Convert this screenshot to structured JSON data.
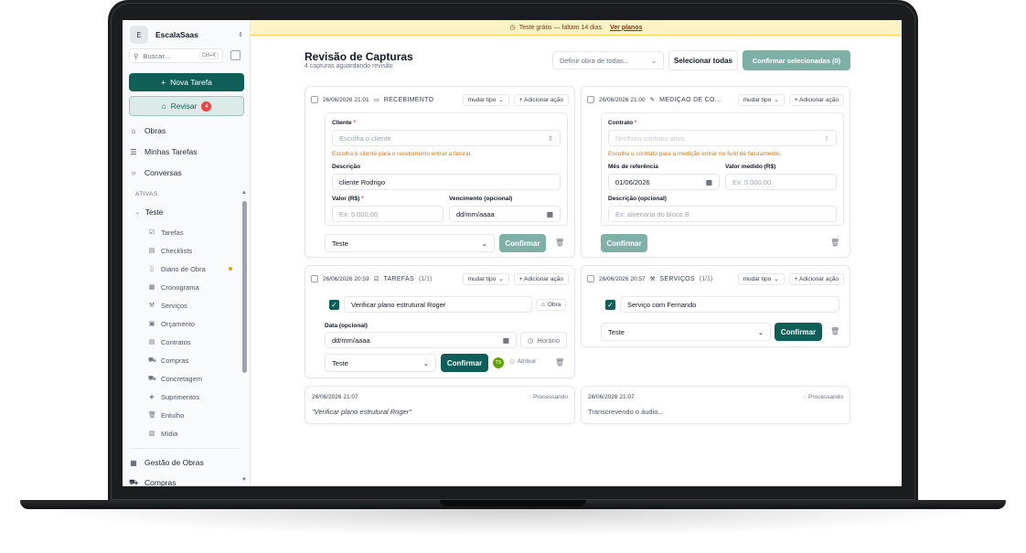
{
  "colors": {
    "brand": "#0f5e57",
    "brand_light": "#dcebe8",
    "warning_text": "#d97706",
    "banner_bg": "#fef3c7",
    "danger": "#ef4444"
  },
  "sidebar": {
    "workspace_initial": "E",
    "workspace_name": "EscalaSaas",
    "search_placeholder": "Buscar...",
    "search_shortcut": "Ctrl+K",
    "new_task_label": "Nova Tarefa",
    "review_label": "Revisar",
    "review_count": "4",
    "nav": [
      {
        "label": "Obras",
        "icon": "home-icon"
      },
      {
        "label": "Minhas Tarefas",
        "icon": "list-icon"
      },
      {
        "label": "Conversas",
        "icon": "chat-icon"
      }
    ],
    "section_label": "ATIVAS",
    "project_name": "Teste",
    "sub_items": [
      "Tarefas",
      "Checklists",
      "Diário de Obra",
      "Cronograma",
      "Serviços",
      "Orçamento",
      "Contratos",
      "Compras",
      "Concretagem",
      "Suprimentos",
      "Entulho",
      "Mídia"
    ],
    "bottom_nav": [
      "Gestão de Obras",
      "Compras"
    ]
  },
  "banner": {
    "text": "Teste grátis — faltam 14 dias.",
    "link": "Ver planos"
  },
  "header": {
    "title": "Revisão de Capturas",
    "subtitle": "4 capturas aguardando revisão",
    "obra_select_placeholder": "Definir obra de todas...",
    "select_all": "Selecionar todas",
    "confirm_selected": "Confirmar selecionadas (0)"
  },
  "common": {
    "change_type": "mudar tipo",
    "add_action": "+ Adicionar ação",
    "confirm": "Confirmar",
    "obra_value": "Teste"
  },
  "cards": {
    "recebimento": {
      "timestamp": "26/06/2026 21:01",
      "type": "RECEBIMENTO",
      "cliente_label": "Cliente",
      "cliente_placeholder": "Escolha o cliente",
      "cliente_warning": "Escolha o cliente para o recebimento entrar a faturar.",
      "descricao_label": "Descrição",
      "descricao_value": "cliente Rodrigo",
      "valor_label": "Valor (R$)",
      "valor_placeholder": "Ex: 5.000,00",
      "vencimento_label": "Vencimento (opcional)",
      "vencimento_placeholder": "dd/mm/aaaa"
    },
    "medicao": {
      "timestamp": "26/06/2026 21:00",
      "type": "MEDIÇÃO DE CO...",
      "contrato_label": "Contrato",
      "contrato_placeholder": "Nenhum contrato ativo",
      "contrato_warning": "Escolha o contrato para a medição entrar no funil de faturamento.",
      "mes_label": "Mês de referência",
      "mes_value": "01/06/2026",
      "valor_label": "Valor medido (R$)",
      "valor_placeholder": "Ex: 5.000,00",
      "descricao_label": "Descrição (opcional)",
      "descricao_placeholder": "Ex: alvenaria do bloco B"
    },
    "tarefas": {
      "timestamp": "26/06/2026 20:59",
      "type": "TAREFAS",
      "count": "(1/1)",
      "item_text": "Verificar plano estrutural Roger",
      "obra_tag": "Obra",
      "data_label": "Data (opcional)",
      "data_placeholder": "dd/mm/aaaa",
      "horario": "Horário",
      "avatar_initials": "TS",
      "atribuir": "Atribuir"
    },
    "servicos": {
      "timestamp": "26/06/2026 20:57",
      "type": "SERVIÇOS",
      "count": "(1/1)",
      "item_text": "Serviço com Fernando"
    },
    "proc1": {
      "timestamp": "26/06/2026 21:07",
      "status": "Processando",
      "text": "\"Verificar plano estrutural Roger\""
    },
    "proc2": {
      "timestamp": "26/06/2026 21:07",
      "status": "Processando",
      "text": "Transcrevendo o áudio..."
    }
  }
}
